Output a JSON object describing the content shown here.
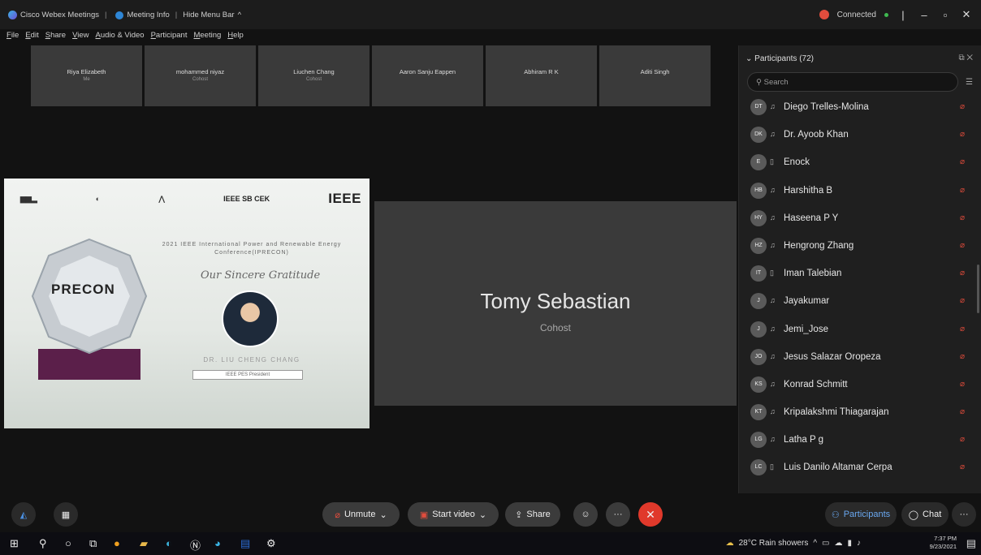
{
  "titlebar": {
    "app_name": "Cisco Webex Meetings",
    "meeting_info": "Meeting Info",
    "hide_menu": "Hide Menu Bar",
    "status": "Connected"
  },
  "menu": [
    "File",
    "Edit",
    "Share",
    "View",
    "Audio & Video",
    "Participant",
    "Meeting",
    "Help"
  ],
  "video_strip": [
    {
      "name": "Riya Elizabeth",
      "role": "Me"
    },
    {
      "name": "mohammed niyaz",
      "role": "Cohost"
    },
    {
      "name": "Liuchen Chang",
      "role": "Cohost"
    },
    {
      "name": "Aaron Sanju Eappen",
      "role": ""
    },
    {
      "name": "Abhiram R K",
      "role": ""
    },
    {
      "name": "Aditi Singh",
      "role": ""
    }
  ],
  "share": {
    "logo_mid": "IEEE SB CEK",
    "logo_big": "IEEE",
    "trophy_text": "PRECON",
    "conference": "2021 IEEE International Power and Renewable Energy Conference(IPRECON)",
    "gratitude": "Our Sincere Gratitude",
    "person_name": "DR. LIU CHENG CHANG",
    "person_role": "IEEE PES President"
  },
  "speaker": {
    "name": "Tomy Sebastian",
    "role": "Cohost"
  },
  "participants": {
    "header": "Participants (72)",
    "search_placeholder": "Search",
    "items": [
      {
        "initials": "DT",
        "name": "Diego Trelles-Molina"
      },
      {
        "initials": "DK",
        "name": "Dr. Ayoob Khan"
      },
      {
        "initials": "E",
        "name": "Enock"
      },
      {
        "initials": "HB",
        "name": "Harshitha B"
      },
      {
        "initials": "HY",
        "name": "Haseena P Y"
      },
      {
        "initials": "HZ",
        "name": "Hengrong Zhang"
      },
      {
        "initials": "IT",
        "name": "Iman Talebian"
      },
      {
        "initials": "J",
        "name": "Jayakumar"
      },
      {
        "initials": "J",
        "name": "Jemi_Jose"
      },
      {
        "initials": "JO",
        "name": "Jesus Salazar Oropeza"
      },
      {
        "initials": "KS",
        "name": "Konrad Schmitt"
      },
      {
        "initials": "KT",
        "name": "Kripalakshmi Thiagarajan"
      },
      {
        "initials": "LG",
        "name": "Latha P g"
      },
      {
        "initials": "LC",
        "name": "Luis Danilo Altamar Cerpa"
      }
    ]
  },
  "controls": {
    "unmute": "Unmute",
    "start_video": "Start video",
    "share": "Share",
    "participants": "Participants",
    "chat": "Chat"
  },
  "taskbar": {
    "weather": "28°C  Rain showers",
    "time": "7:37 PM",
    "date": "9/23/2021"
  }
}
